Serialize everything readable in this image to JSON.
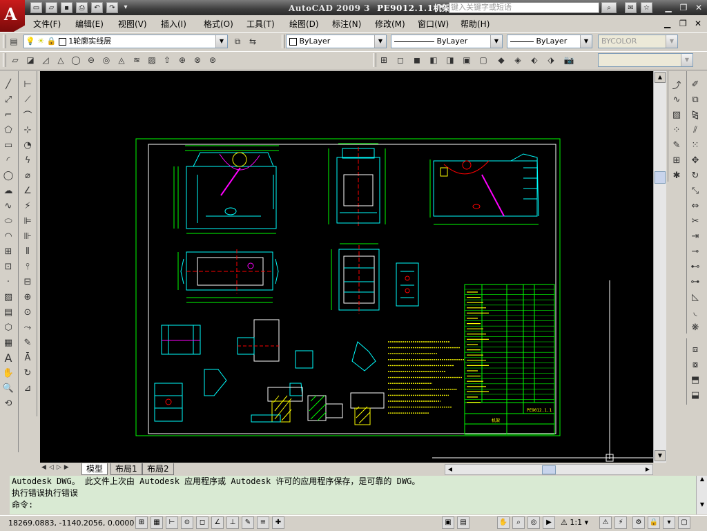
{
  "window": {
    "app_title": "AutoCAD 2009 3",
    "file_name": "PE9012.1.1机架",
    "search_placeholder": "键入关键字或短语"
  },
  "menu": [
    "文件(F)",
    "编辑(E)",
    "视图(V)",
    "插入(I)",
    "格式(O)",
    "工具(T)",
    "绘图(D)",
    "标注(N)",
    "修改(M)",
    "窗口(W)",
    "帮助(H)"
  ],
  "layers": {
    "current_layer": "1轮廓实线层",
    "color": "ByLayer",
    "linetype": "ByLayer",
    "lineweight": "ByLayer",
    "plotstyle": "BYCOLOR"
  },
  "layout_tabs": [
    "模型",
    "布局1",
    "布局2"
  ],
  "command_lines": [
    "Autodesk DWG。  此文件上次由 Autodesk 应用程序或 Autodesk 许可的应用程序保存，是可靠的 DWG。",
    "执行错误执行错误",
    "命令:"
  ],
  "status": {
    "coordinates": "18269.0883, -1140.2056, 0.0000",
    "annotation_scale": "1:1"
  },
  "drawing": {
    "title_block_number": "PE9012.1.1",
    "title_block_name": "机架"
  },
  "colors": {
    "title_bar": "#3e3e3e",
    "canvas_bg": "#000000",
    "frame": "#ffffff",
    "geometry": "#00ffff",
    "dimension": "#00ff00",
    "highlight": "#ffff00",
    "center_line": "#ff0000",
    "accent": "#ff00ff",
    "command_bg": "#d9ead3"
  }
}
